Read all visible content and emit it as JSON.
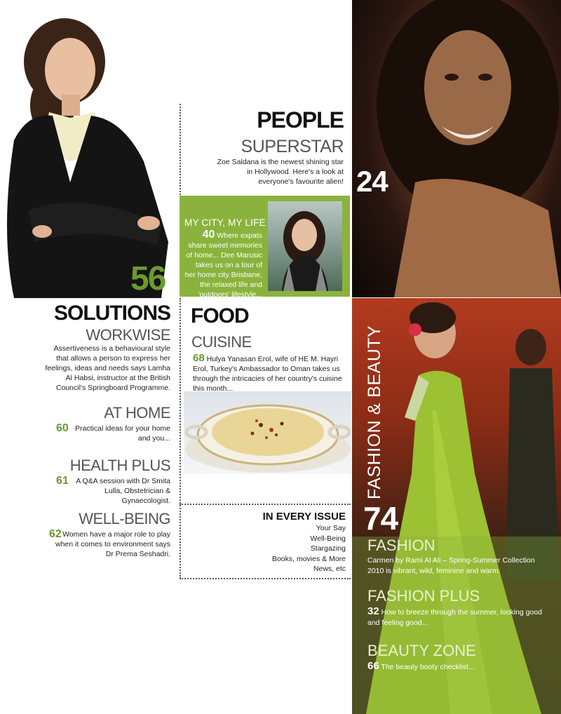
{
  "solutions": {
    "page_num": "56",
    "heading": "SOLUTIONS",
    "workwise": {
      "title": "WORKWISE",
      "text": "Assertiveness is a behavioural style that allows a person to express her feelings, ideas and needs says Lamha Al Habsi, instructor at the British Council's Springboard Programme."
    },
    "at_home": {
      "title": "AT HOME",
      "num": "60",
      "text": "Practical ideas for your home and you..."
    },
    "health_plus": {
      "title": "HEALTH PLUS",
      "num": "61",
      "text": "A Q&A session with Dr Smita Lulla, Obstetrician & Gynaecologist."
    },
    "well_being": {
      "title": "WELL-BEING",
      "num": "62",
      "text": "Women have a major role to play when it comes to environment says Dr Prema Seshadri."
    }
  },
  "people": {
    "heading": "PEOPLE",
    "superstar": {
      "title": "SUPERSTAR",
      "text": "Zoe Saldana is the newest shining star in Hollywood. Here's a look at everyone's favourite alien!"
    },
    "page_num": "24",
    "city": {
      "title": "MY CITY, MY LIFE",
      "num": "40",
      "text": "Where expats share sweet memories of home... Dee Marusic takes us on a tour of her home city Brisbane, the relaxed life and 'outdoors' lifestyle..."
    }
  },
  "food": {
    "heading": "FOOD",
    "cuisine": {
      "title": "CUISINE",
      "num": "68",
      "text": "Hulya Yanasan Erol, wife of HE M. Hayri Erol, Turkey's Ambassador to Oman takes us through the intricacies of her country's cuisine this month..."
    }
  },
  "every_issue": {
    "title": "IN EVERY ISSUE",
    "items": [
      "Your Say",
      "Well-Being",
      "Stargazing",
      "Books, movies & More",
      "News, etc"
    ]
  },
  "fashion": {
    "vertical_heading": "FASHION & BEAUTY",
    "page_num": "74",
    "fashion": {
      "title": "FASHION",
      "text": "Carmen by Rami Al Ali – Spring-Summer Collection 2010 is vibrant, wild, feminine and warm."
    },
    "fashion_plus": {
      "title": "FASHION PLUS",
      "num": "32",
      "text": "How to breeze through the summer, looking good and feeling good..."
    },
    "beauty_zone": {
      "title": "BEAUTY ZONE",
      "num": "66",
      "text": "The beauty booty checklist..."
    }
  },
  "colors": {
    "accent_green": "#7aa83a",
    "city_box": "#8ab33d"
  }
}
